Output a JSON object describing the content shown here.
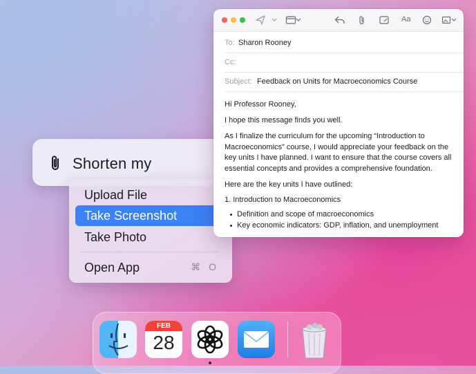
{
  "assistant": {
    "prompt_text": "Shorten my"
  },
  "attach_menu": {
    "items": [
      {
        "label": "Upload File"
      },
      {
        "label": "Take Screenshot",
        "selected": true
      },
      {
        "label": "Take Photo"
      },
      {
        "label": "Open App",
        "shortcut": "⌘ O"
      }
    ]
  },
  "mail": {
    "toolbar": {
      "format_label": "Aa"
    },
    "fields": {
      "to_label": "To:",
      "to_value": "Sharon Rooney",
      "cc_label": "Cc:",
      "cc_value": "",
      "subject_label": "Subject:",
      "subject_value": "Feedback on Units for Macroeconomics Course"
    },
    "body": {
      "greeting": "Hi Professor Rooney,",
      "line1": "I hope this message finds you well.",
      "paragraph": "As I finalize the curriculum for the upcoming “Introduction to Macroeconomics” course, I would appreciate your feedback on the key units I have planned. I want to ensure that the course covers all essential concepts and provides a comprehensive foundation.",
      "units_intro": "Here are the key units I have outlined:",
      "unit1_title": "1. Introduction to Macroeconomics",
      "unit1_bullets": [
        "Definition and scope of macroeconomics",
        "Key economic indicators: GDP, inflation, and unemployment"
      ]
    }
  },
  "dock": {
    "calendar_month": "FEB",
    "calendar_day": "28",
    "apps": [
      "Finder",
      "Calendar",
      "ChatGPT",
      "Mail",
      "Trash"
    ]
  },
  "colors": {
    "selection": "#3b82f6",
    "traffic_red": "#ff5f57",
    "traffic_yellow": "#febc2e",
    "traffic_green": "#28c840",
    "mail_blue": "#1f8bf5"
  }
}
